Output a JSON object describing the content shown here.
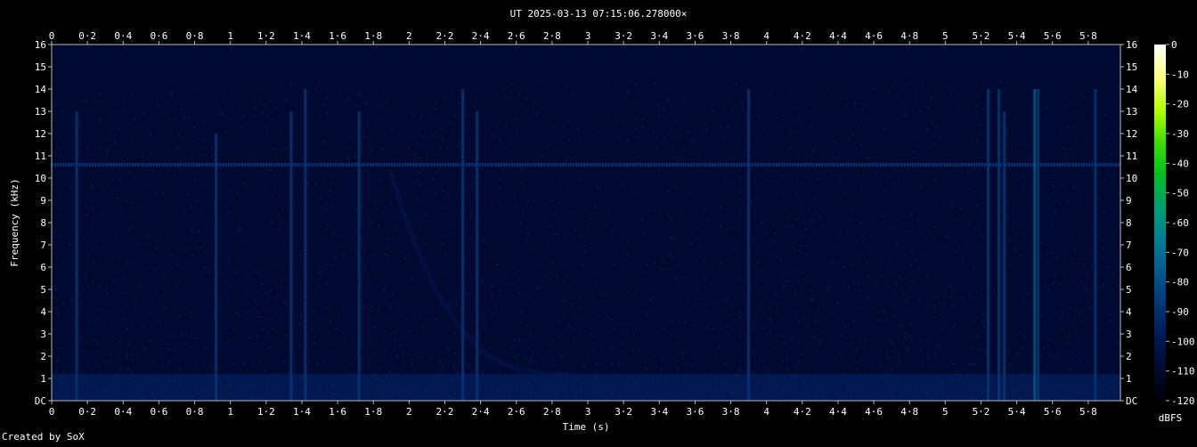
{
  "chart_data": {
    "type": "heatmap",
    "title": "UT 2025-03-13 07:15:06.278000×",
    "xlabel": "Time (s)",
    "ylabel": "Frequency (kHz)",
    "footer": "Created by SoX",
    "colorbar_label": "dBFS",
    "xlim": [
      0,
      5.98
    ],
    "ylim": [
      0,
      16
    ],
    "x_ticks": [
      "0",
      "0·2",
      "0·4",
      "0·6",
      "0·8",
      "1",
      "1·2",
      "1·4",
      "1·6",
      "1·8",
      "2",
      "2·2",
      "2·4",
      "2·6",
      "2·8",
      "3",
      "3·2",
      "3·4",
      "3·6",
      "3·8",
      "4",
      "4·2",
      "4·4",
      "4·6",
      "4·8",
      "5",
      "5·2",
      "5·4",
      "5·6",
      "5·8"
    ],
    "y_ticks": [
      "DC",
      "1",
      "2",
      "3",
      "4",
      "5",
      "6",
      "7",
      "8",
      "9",
      "10",
      "11",
      "12",
      "13",
      "14",
      "15",
      "16"
    ],
    "colorbar_ticks": [
      "0",
      "-10",
      "-20",
      "-30",
      "-40",
      "-50",
      "-60",
      "-70",
      "-80",
      "-90",
      "-100",
      "-110",
      "-120"
    ],
    "colorbar_range": [
      -120,
      0
    ],
    "colormap": [
      "#ffffff",
      "#ffff80",
      "#b4ff00",
      "#40e000",
      "#00c020",
      "#00a070",
      "#008098",
      "#005a90",
      "#003878",
      "#001a58",
      "#000a30",
      "#000008"
    ],
    "background_db": -110,
    "features": [
      {
        "name": "carrier",
        "type": "horizontal_line",
        "freq_khz": 10.6,
        "level_db": -88
      },
      {
        "name": "whistler",
        "type": "descending_tone",
        "t_start": 1.9,
        "t_end": 2.9,
        "f_start_khz": 10.2,
        "f_end_khz": 1.2,
        "level_db": -95
      },
      {
        "name": "sferics",
        "type": "vertical_impulses",
        "times_s": [
          0.14,
          0.92,
          1.34,
          1.42,
          1.72,
          2.3,
          2.38,
          3.9,
          5.24,
          5.3,
          5.33,
          5.5,
          5.52,
          5.84
        ],
        "max_freq_khz": [
          13,
          12,
          13,
          14,
          13,
          14,
          13,
          14,
          14,
          14,
          13,
          14,
          14,
          14
        ],
        "level_db": [
          -85,
          -92,
          -92,
          -82,
          -90,
          -90,
          -88,
          -88,
          -88,
          -88,
          -92,
          -80,
          -84,
          -86
        ]
      }
    ]
  }
}
